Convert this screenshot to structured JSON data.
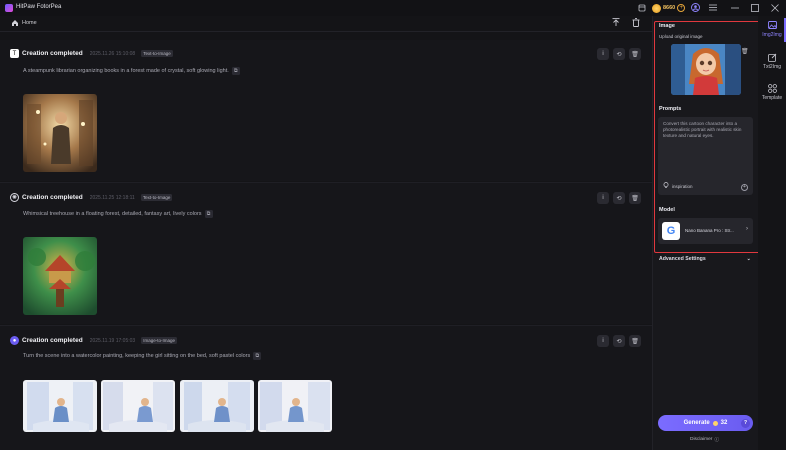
{
  "app": {
    "title": "HitPaw FotorPea",
    "coins": "8660"
  },
  "breadcrumb": {
    "home": "Home"
  },
  "cards": [
    {
      "status": "Creation completed",
      "time": "2025.11.26  15:10:08",
      "tag": "Text-to-Image",
      "prompt": "A steampunk librarian organizing books in a forest made of crystal, soft glowing light."
    },
    {
      "status": "Creation completed",
      "time": "2025.11.25  12:18:11",
      "tag": "Text-to-Image",
      "prompt": "Whimsical treehouse in a floating forest, detailed, fantasy art, lively colors"
    },
    {
      "status": "Creation completed",
      "time": "2025.11.19  17:05:03",
      "tag": "Image-to-Image",
      "prompt": "Turn the scene into a watercolor painting, keeping the girl sitting on the bed, soft pastel colors"
    }
  ],
  "panel": {
    "image_title": "Image",
    "upload_label": "Upload original image",
    "prompts_title": "Prompts",
    "prompt_text": "Convert this cartoon character into a photorealistic portrait with realistic skin texture and natural eyes.",
    "inspiration": "inspiration",
    "model_title": "Model",
    "model_name": "Nano Banana Pro : Str...",
    "advanced": "Advanced Settings",
    "generate": "Generate",
    "generate_cost": "32",
    "disclaimer": "Disclaimer"
  },
  "nav": [
    {
      "label": "Img2Img",
      "icon": "image-icon",
      "active": true
    },
    {
      "label": "Txt2Img",
      "icon": "edit-icon",
      "active": false
    },
    {
      "label": "Template",
      "icon": "grid-icon",
      "active": false
    }
  ]
}
